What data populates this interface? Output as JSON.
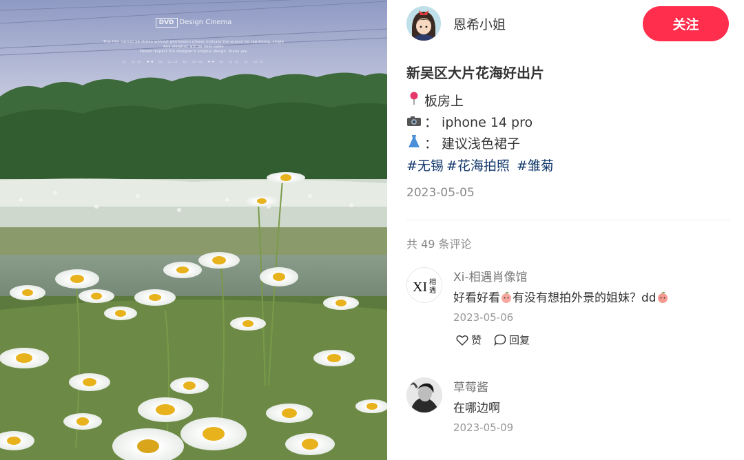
{
  "photo": {
    "watermark_logo": "DVD",
    "watermark_brand": "Design Cinema",
    "watermark_line1": "This film cannot be stolen without permission please indicate the source for reprinting, single",
    "watermark_line2": "Any violation will be held liable",
    "watermark_line3": "Please respect the designer's original design, thank you",
    "watermark_dots": "▭ ▭▭ ◂◂ ▭ ▭▭ ▭ ▭▭ ◂◂ ▭ ▭▭ ▭ ▭▭"
  },
  "author": {
    "name": "恩希小姐",
    "follow_label": "关注",
    "follow_color": "#ff2e4d"
  },
  "post": {
    "title": "新吴区大片花海好出片",
    "location_icon": "pin-icon",
    "location": "板房上",
    "camera_icon": "camera-icon",
    "camera": "：  iphone 14 pro",
    "dress_icon": "dress-icon",
    "dress": "：  建议浅色裙子",
    "tags": [
      "#无锡",
      "#花海拍照",
      "#雏菊"
    ],
    "tag_color": "#13386c",
    "date": "2023-05-05"
  },
  "comments_header": "共 49 条评论",
  "comments": [
    {
      "avatar_text": "XI相遇",
      "name": "Xi-相遇肖像馆",
      "text_part1": "好看好看",
      "text_part2": "有没有想拍外景的姐妹？dd",
      "date": "2023-05-06",
      "like_label": "赞",
      "reply_label": "回复"
    },
    {
      "name": "草莓酱",
      "text": "在哪边啊",
      "date": "2023-05-09"
    }
  ]
}
